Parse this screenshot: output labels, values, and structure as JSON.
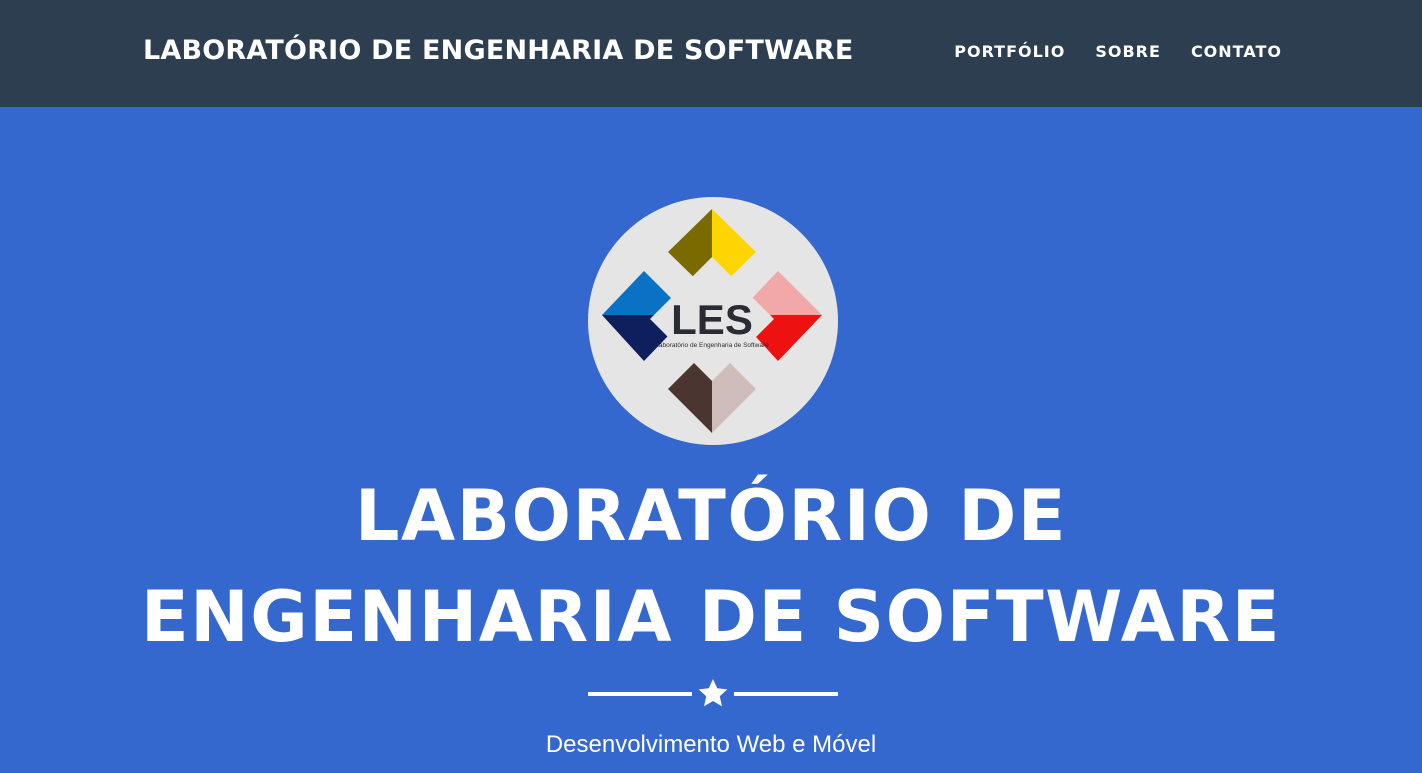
{
  "navbar": {
    "brand": "LABORATÓRIO DE ENGENHARIA DE SOFTWARE",
    "links": [
      "PORTFÓLIO",
      "SOBRE",
      "CONTATO"
    ]
  },
  "hero": {
    "logo": {
      "text": "LES",
      "caption": "Laboratório de Engenharia de Software"
    },
    "title_line1": "LABORATÓRIO DE",
    "title_line2": "ENGENHARIA DE SOFTWARE",
    "divider_icon": "star-icon",
    "subtitle": "Desenvolvimento Web e Móvel"
  },
  "colors": {
    "navbar_bg": "#2c3e50",
    "hero_bg": "#3468cf",
    "text": "#ffffff",
    "logo_bg": "#e6e5e6"
  }
}
